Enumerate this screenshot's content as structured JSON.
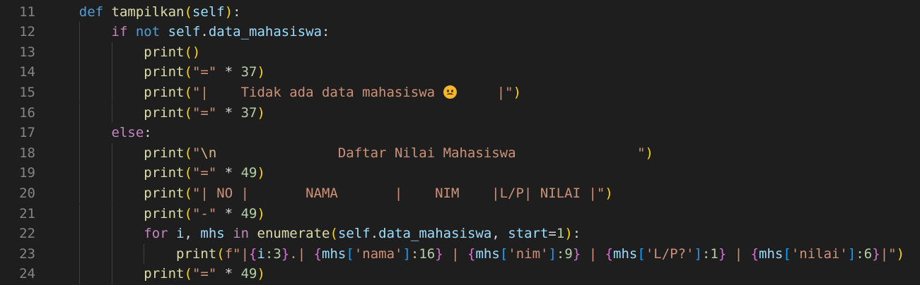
{
  "lines": [
    {
      "n": "11",
      "tokens": [
        {
          "t": "    ",
          "c": ""
        },
        {
          "t": "def",
          "c": "kw"
        },
        {
          "t": " ",
          "c": ""
        },
        {
          "t": "tampilkan",
          "c": "fn"
        },
        {
          "t": "(",
          "c": "b1"
        },
        {
          "t": "self",
          "c": "var"
        },
        {
          "t": ")",
          "c": "b1"
        },
        {
          "t": ":",
          "c": "op"
        }
      ]
    },
    {
      "n": "12",
      "tokens": [
        {
          "t": "        ",
          "c": ""
        },
        {
          "t": "if",
          "c": "ctl"
        },
        {
          "t": " ",
          "c": ""
        },
        {
          "t": "not",
          "c": "kw"
        },
        {
          "t": " ",
          "c": ""
        },
        {
          "t": "self",
          "c": "var"
        },
        {
          "t": ".",
          "c": "op"
        },
        {
          "t": "data_mahasiswa",
          "c": "var"
        },
        {
          "t": ":",
          "c": "op"
        }
      ]
    },
    {
      "n": "13",
      "tokens": [
        {
          "t": "            ",
          "c": ""
        },
        {
          "t": "print",
          "c": "fn"
        },
        {
          "t": "()",
          "c": "b1"
        }
      ]
    },
    {
      "n": "14",
      "tokens": [
        {
          "t": "            ",
          "c": ""
        },
        {
          "t": "print",
          "c": "fn"
        },
        {
          "t": "(",
          "c": "b1"
        },
        {
          "t": "\"=\"",
          "c": "str"
        },
        {
          "t": " * ",
          "c": "op"
        },
        {
          "t": "37",
          "c": "num"
        },
        {
          "t": ")",
          "c": "b1"
        }
      ]
    },
    {
      "n": "15",
      "tokens": [
        {
          "t": "            ",
          "c": ""
        },
        {
          "t": "print",
          "c": "fn"
        },
        {
          "t": "(",
          "c": "b1"
        },
        {
          "t": "\"|    Tidak ada data mahasiswa ",
          "c": "str"
        },
        {
          "t": "",
          "c": "emoji"
        },
        {
          "t": "     |\"",
          "c": "str"
        },
        {
          "t": ")",
          "c": "b1"
        }
      ]
    },
    {
      "n": "16",
      "tokens": [
        {
          "t": "            ",
          "c": ""
        },
        {
          "t": "print",
          "c": "fn"
        },
        {
          "t": "(",
          "c": "b1"
        },
        {
          "t": "\"=\"",
          "c": "str"
        },
        {
          "t": " * ",
          "c": "op"
        },
        {
          "t": "37",
          "c": "num"
        },
        {
          "t": ")",
          "c": "b1"
        }
      ]
    },
    {
      "n": "17",
      "tokens": [
        {
          "t": "        ",
          "c": ""
        },
        {
          "t": "else",
          "c": "ctl"
        },
        {
          "t": ":",
          "c": "op"
        }
      ]
    },
    {
      "n": "18",
      "tokens": [
        {
          "t": "            ",
          "c": ""
        },
        {
          "t": "print",
          "c": "fn"
        },
        {
          "t": "(",
          "c": "b1"
        },
        {
          "t": "\"",
          "c": "str"
        },
        {
          "t": "\\n",
          "c": "esc"
        },
        {
          "t": "               Daftar Nilai Mahasiswa               \"",
          "c": "str"
        },
        {
          "t": ")",
          "c": "b1"
        }
      ]
    },
    {
      "n": "19",
      "tokens": [
        {
          "t": "            ",
          "c": ""
        },
        {
          "t": "print",
          "c": "fn"
        },
        {
          "t": "(",
          "c": "b1"
        },
        {
          "t": "\"=\"",
          "c": "str"
        },
        {
          "t": " * ",
          "c": "op"
        },
        {
          "t": "49",
          "c": "num"
        },
        {
          "t": ")",
          "c": "b1"
        }
      ]
    },
    {
      "n": "20",
      "tokens": [
        {
          "t": "            ",
          "c": ""
        },
        {
          "t": "print",
          "c": "fn"
        },
        {
          "t": "(",
          "c": "b1"
        },
        {
          "t": "\"| NO |       NAMA       |    NIM    |L/P| NILAI |\"",
          "c": "str"
        },
        {
          "t": ")",
          "c": "b1"
        }
      ]
    },
    {
      "n": "21",
      "tokens": [
        {
          "t": "            ",
          "c": ""
        },
        {
          "t": "print",
          "c": "fn"
        },
        {
          "t": "(",
          "c": "b1"
        },
        {
          "t": "\"-\"",
          "c": "str"
        },
        {
          "t": " * ",
          "c": "op"
        },
        {
          "t": "49",
          "c": "num"
        },
        {
          "t": ")",
          "c": "b1"
        }
      ]
    },
    {
      "n": "22",
      "tokens": [
        {
          "t": "            ",
          "c": ""
        },
        {
          "t": "for",
          "c": "ctl"
        },
        {
          "t": " ",
          "c": ""
        },
        {
          "t": "i",
          "c": "var"
        },
        {
          "t": ", ",
          "c": "op"
        },
        {
          "t": "mhs",
          "c": "var"
        },
        {
          "t": " ",
          "c": ""
        },
        {
          "t": "in",
          "c": "ctl"
        },
        {
          "t": " ",
          "c": ""
        },
        {
          "t": "enumerate",
          "c": "fn"
        },
        {
          "t": "(",
          "c": "b1"
        },
        {
          "t": "self",
          "c": "var"
        },
        {
          "t": ".",
          "c": "op"
        },
        {
          "t": "data_mahasiswa",
          "c": "var"
        },
        {
          "t": ", ",
          "c": "op"
        },
        {
          "t": "start",
          "c": "var"
        },
        {
          "t": "=",
          "c": "op"
        },
        {
          "t": "1",
          "c": "num"
        },
        {
          "t": ")",
          "c": "b1"
        },
        {
          "t": ":",
          "c": "op"
        }
      ]
    },
    {
      "n": "23",
      "tokens": [
        {
          "t": "                ",
          "c": ""
        },
        {
          "t": "print",
          "c": "fn"
        },
        {
          "t": "(",
          "c": "b1"
        },
        {
          "t": "f\"|",
          "c": "str"
        },
        {
          "t": "{",
          "c": "b2"
        },
        {
          "t": "i",
          "c": "var"
        },
        {
          "t": ":3",
          "c": "num"
        },
        {
          "t": "}",
          "c": "b2"
        },
        {
          "t": ".| ",
          "c": "str"
        },
        {
          "t": "{",
          "c": "b2"
        },
        {
          "t": "mhs",
          "c": "var"
        },
        {
          "t": "[",
          "c": "b3"
        },
        {
          "t": "'nama'",
          "c": "str"
        },
        {
          "t": "]",
          "c": "b3"
        },
        {
          "t": ":16",
          "c": "num"
        },
        {
          "t": "}",
          "c": "b2"
        },
        {
          "t": " | ",
          "c": "str"
        },
        {
          "t": "{",
          "c": "b2"
        },
        {
          "t": "mhs",
          "c": "var"
        },
        {
          "t": "[",
          "c": "b3"
        },
        {
          "t": "'nim'",
          "c": "str"
        },
        {
          "t": "]",
          "c": "b3"
        },
        {
          "t": ":9",
          "c": "num"
        },
        {
          "t": "}",
          "c": "b2"
        },
        {
          "t": " | ",
          "c": "str"
        },
        {
          "t": "{",
          "c": "b2"
        },
        {
          "t": "mhs",
          "c": "var"
        },
        {
          "t": "[",
          "c": "b3"
        },
        {
          "t": "'L/P?'",
          "c": "str"
        },
        {
          "t": "]",
          "c": "b3"
        },
        {
          "t": ":1",
          "c": "num"
        },
        {
          "t": "}",
          "c": "b2"
        },
        {
          "t": " | ",
          "c": "str"
        },
        {
          "t": "{",
          "c": "b2"
        },
        {
          "t": "mhs",
          "c": "var"
        },
        {
          "t": "[",
          "c": "b3"
        },
        {
          "t": "'nilai'",
          "c": "str"
        },
        {
          "t": "]",
          "c": "b3"
        },
        {
          "t": ":6",
          "c": "num"
        },
        {
          "t": "}",
          "c": "b2"
        },
        {
          "t": "|\"",
          "c": "str"
        },
        {
          "t": ")",
          "c": "b1"
        }
      ]
    },
    {
      "n": "24",
      "tokens": [
        {
          "t": "            ",
          "c": ""
        },
        {
          "t": "print",
          "c": "fn"
        },
        {
          "t": "(",
          "c": "b1"
        },
        {
          "t": "\"=\"",
          "c": "str"
        },
        {
          "t": " * ",
          "c": "op"
        },
        {
          "t": "49",
          "c": "num"
        },
        {
          "t": ")",
          "c": "b1"
        }
      ]
    }
  ],
  "theme": {
    "background": "#1e1e1e",
    "keyword": "#569cd6",
    "control": "#c586c0",
    "function": "#dcdcaa",
    "variable": "#9cdcfe",
    "string": "#ce9178",
    "number": "#b5cea8",
    "bracket": "#ffd700",
    "line_number": "#858585"
  },
  "icons": {
    "emoji": "sad-face-emoji-icon"
  }
}
